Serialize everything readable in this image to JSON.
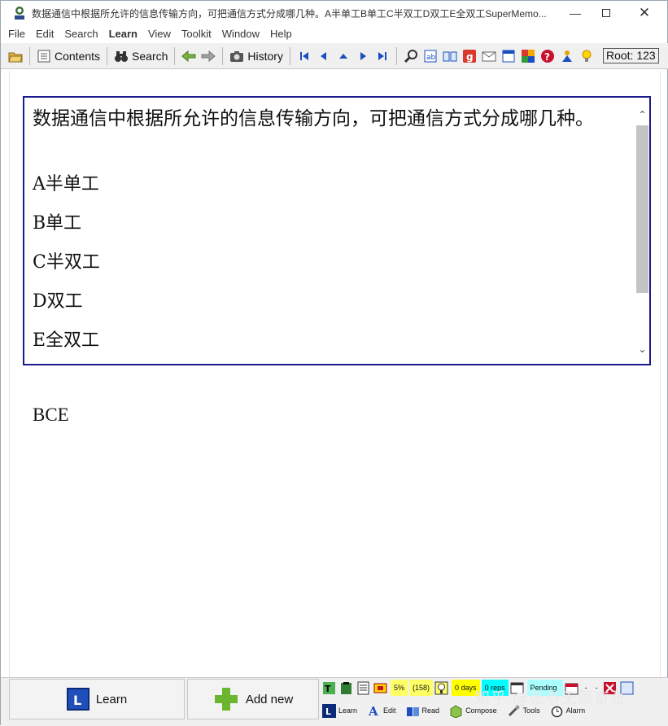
{
  "window": {
    "title": "数据通信中根据所允许的信息传输方向，可把通信方式分成哪几种。A半单工B单工C半双工D双工E全双工SuperMemo..."
  },
  "menu": {
    "items": [
      "File",
      "Edit",
      "Search",
      "Learn",
      "View",
      "Toolkit",
      "Window",
      "Help"
    ]
  },
  "toolbar": {
    "contents_label": "Contents",
    "search_label": "Search",
    "history_label": "History",
    "root_label": "Root: 123"
  },
  "question": {
    "text": "数据通信中根据所允许的信息传输方向，可把通信方式分成哪几种。",
    "options": [
      "A半单工",
      "B单工",
      "C半双工",
      "D双工",
      "E全双工"
    ]
  },
  "answer": {
    "text": "BCE"
  },
  "bottom": {
    "learn_button": "Learn",
    "add_new_button": "Add new",
    "status": {
      "percent": "5%",
      "count": "(158)",
      "days": "0 days",
      "reps": "0 reps",
      "pending": "Pending"
    },
    "modes": [
      "Learn",
      "Edit",
      "Read",
      "Compose",
      "Tools",
      "Alarm"
    ]
  },
  "watermark": "知乎 @张爷无限奋张",
  "colors": {
    "question_border": "#1a1a8c",
    "days_bg": "#ffff00",
    "reps_bg": "#00ffff",
    "pending_bg": "#00ffff",
    "percent_bg": "#ffff66"
  }
}
